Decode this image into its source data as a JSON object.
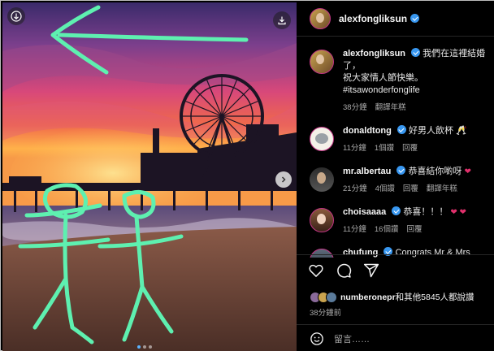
{
  "header": {
    "username": "alexfongliksun"
  },
  "caption": {
    "username": "alexfongliksun",
    "line1": "我們在這裡結婚了，",
    "line2": "祝大家情人節快樂。",
    "hashtag": "#itsawonderfonglife",
    "time": "38分鐘",
    "translate": "翻譯年糕"
  },
  "comments": [
    {
      "username": "donaldtong",
      "text": "好男人飲杯 🥂",
      "time": "11分鐘",
      "likes": "1個讚",
      "reply": "回覆",
      "translate": ""
    },
    {
      "username": "mr.albertau",
      "text": "恭喜結你喲呀",
      "time": "21分鐘",
      "likes": "4個讚",
      "reply": "回覆",
      "translate": "翻譯年糕"
    },
    {
      "username": "choisaaaa",
      "text": "恭喜！！！",
      "time": "11分鐘",
      "likes": "16個讚",
      "reply": "回覆",
      "translate": ""
    },
    {
      "username": "chufung",
      "text": "Congrats Mr & Mrs Fong !",
      "time": "",
      "likes": "",
      "reply": "",
      "translate": ""
    }
  ],
  "likes": {
    "first_user": "numberonepr",
    "rest": "和其他5845人都說讚"
  },
  "post_time": "38分鐘前",
  "add_comment_placeholder": "留言……",
  "icons": [
    "download-icon",
    "save-icon",
    "next-arrow-icon",
    "heart-icon",
    "comment-icon",
    "share-icon",
    "emoji-icon",
    "verified-icon"
  ],
  "colors": {
    "background": "#000000",
    "verified": "#3897f0",
    "drawing": "#5ef0b0",
    "heart": "#e1306c"
  }
}
